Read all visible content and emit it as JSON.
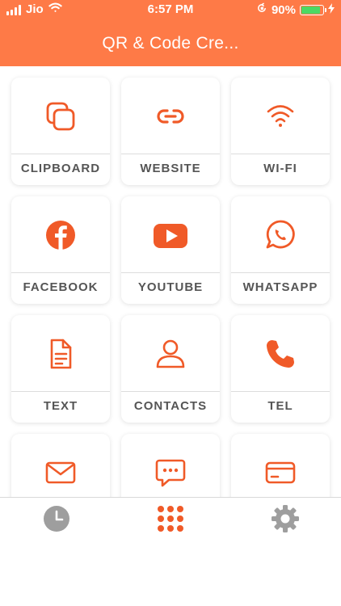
{
  "status_bar": {
    "carrier": "Jio",
    "time": "6:57 PM",
    "battery": "90%",
    "battery_level": 0.9
  },
  "header": {
    "title": "QR & Code Cre..."
  },
  "tiles": [
    {
      "label": "CLIPBOARD",
      "icon": "clipboard-icon"
    },
    {
      "label": "WEBSITE",
      "icon": "link-icon"
    },
    {
      "label": "WI-FI",
      "icon": "wifi-icon"
    },
    {
      "label": "FACEBOOK",
      "icon": "facebook-icon"
    },
    {
      "label": "YOUTUBE",
      "icon": "youtube-icon"
    },
    {
      "label": "WHATSAPP",
      "icon": "whatsapp-icon"
    },
    {
      "label": "TEXT",
      "icon": "document-icon"
    },
    {
      "label": "CONTACTS",
      "icon": "person-icon"
    },
    {
      "label": "TEL",
      "icon": "phone-icon"
    },
    {
      "label": "",
      "icon": "mail-icon"
    },
    {
      "label": "",
      "icon": "sms-icon"
    },
    {
      "label": "",
      "icon": "card-icon"
    }
  ],
  "tabbar": {
    "items": [
      {
        "icon": "clock-icon",
        "active": false
      },
      {
        "icon": "grid-icon",
        "active": true
      },
      {
        "icon": "gear-icon",
        "active": false
      }
    ]
  },
  "colors": {
    "accent": "#FE7A47",
    "icon": "#F05A28",
    "label": "#555555",
    "inactive_tab": "#9E9E9E"
  }
}
